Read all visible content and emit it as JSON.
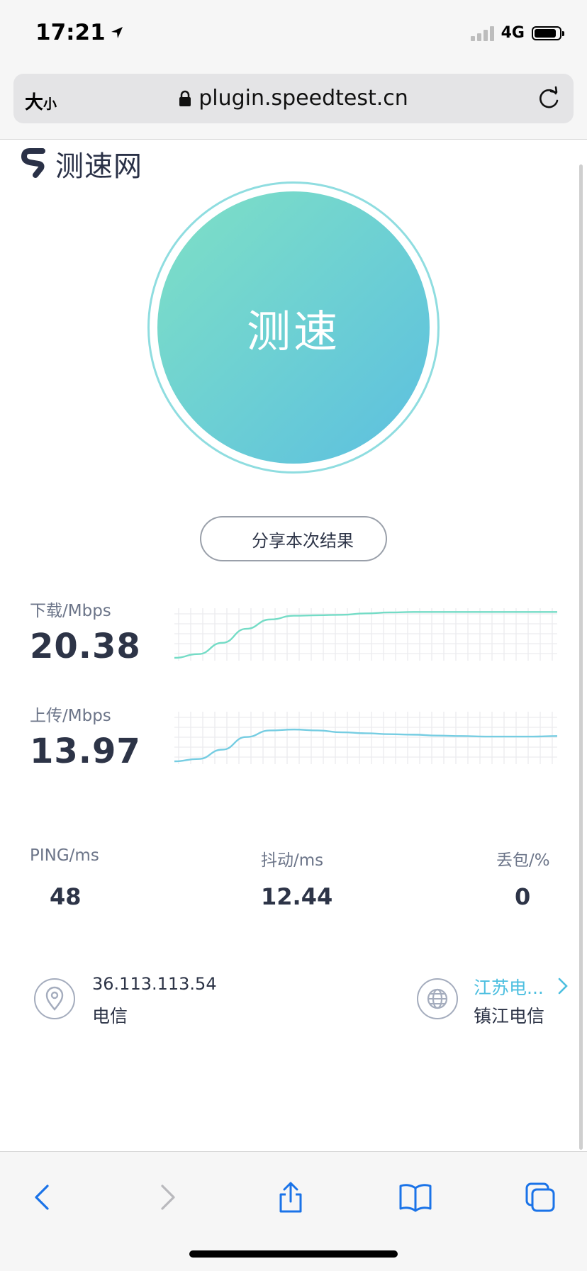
{
  "status_bar": {
    "time": "17:21",
    "network": "4G"
  },
  "browser": {
    "text_size_big": "大",
    "text_size_small": "小",
    "url": "plugin.speedtest.cn"
  },
  "site": {
    "logo_text": "测速网"
  },
  "test": {
    "start_label": "测速",
    "share_label": "分享本次结果"
  },
  "download": {
    "label": "下载/Mbps",
    "value": "20.38",
    "curve": [
      0.0,
      0.08,
      0.32,
      0.62,
      0.82,
      0.9,
      0.91,
      0.92,
      0.95,
      0.97,
      0.98,
      0.98,
      0.98,
      0.98,
      0.98,
      0.98,
      0.98
    ],
    "color": "#74dcc6"
  },
  "upload": {
    "label": "上传/Mbps",
    "value": "13.97",
    "curve": [
      0.0,
      0.05,
      0.25,
      0.52,
      0.66,
      0.68,
      0.66,
      0.62,
      0.6,
      0.58,
      0.57,
      0.55,
      0.54,
      0.53,
      0.53,
      0.53,
      0.54
    ],
    "color": "#76cde2"
  },
  "stats": {
    "ping": {
      "label": "PING/ms",
      "value": "48"
    },
    "jitter": {
      "label": "抖动/ms",
      "value": "12.44"
    },
    "loss": {
      "label": "丢包/%",
      "value": "0"
    }
  },
  "client": {
    "ip": "36.113.113.54",
    "isp": "电信"
  },
  "server": {
    "name": "江苏电...",
    "node": "镇江电信"
  },
  "icons": [
    "location-arrow-icon",
    "signal-icon",
    "battery-icon",
    "lock-icon",
    "reload-icon",
    "logo-icon",
    "location-pin-icon",
    "globe-icon",
    "chevron-right-icon",
    "back-icon",
    "forward-icon",
    "share-icon",
    "bookmarks-icon",
    "tabs-icon"
  ],
  "colors": {
    "accent": "#4dbfe0",
    "gradient_start": "#7fe0c5",
    "gradient_end": "#5cbfe0"
  }
}
